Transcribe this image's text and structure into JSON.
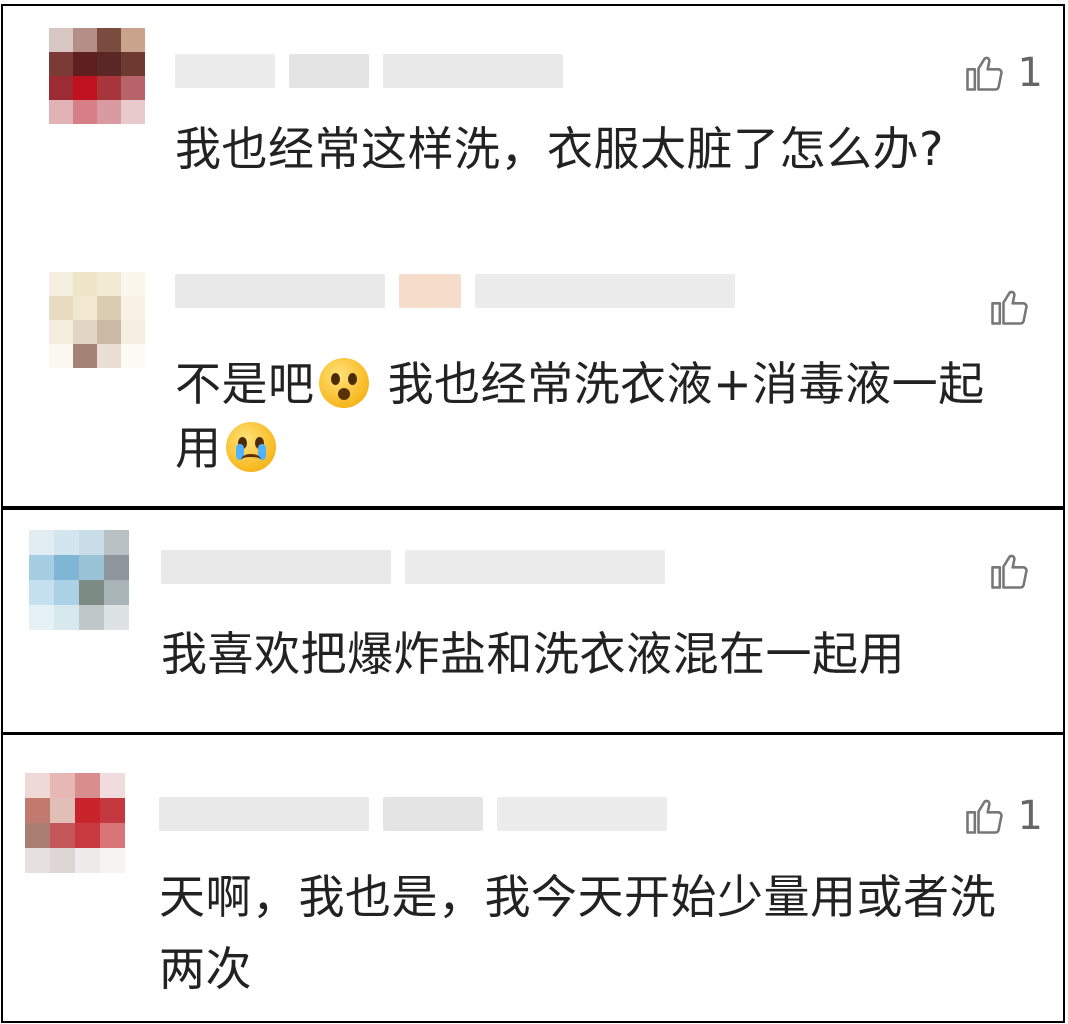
{
  "comments": [
    {
      "likes": "1",
      "lines": [
        "我也经常这样洗，衣服太脏了怎么办?"
      ]
    },
    {
      "likes": "",
      "lines": [
        "不是吧",
        "我也经常洗衣液+消毒液一起",
        "用"
      ],
      "emojis": [
        "astonished-emoji",
        "crying-emoji"
      ]
    },
    {
      "likes": "",
      "lines": [
        "我喜欢把爆炸盐和洗衣液混在一起用"
      ]
    },
    {
      "likes": "1",
      "lines": [
        "天啊，我也是，我今天开始少量用或者洗",
        "两次"
      ]
    }
  ],
  "icons": {
    "like": "thumbs-up-icon"
  },
  "colors": {
    "text": "#222222",
    "muted": "#666666",
    "border": "#000000"
  }
}
